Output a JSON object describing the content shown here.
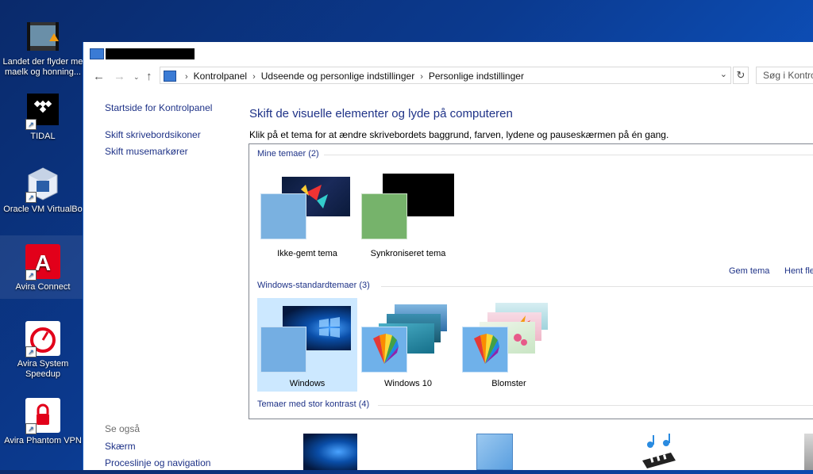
{
  "desktop": {
    "icons": [
      {
        "label1": "Landet der flyder me",
        "label2": "maelk og honning...",
        "icon": "video-file-icon"
      },
      {
        "label1": "TIDAL",
        "label2": "",
        "icon": "tidal-icon"
      },
      {
        "label1": "Oracle VM VirtualBo",
        "label2": "",
        "icon": "virtualbox-icon"
      },
      {
        "label1": "Avira Connect",
        "label2": "",
        "icon": "avira-connect-icon"
      },
      {
        "label1": "Avira System",
        "label2": "Speedup",
        "icon": "avira-speedup-icon"
      },
      {
        "label1": "Avira Phantom VPN",
        "label2": "",
        "icon": "avira-vpn-icon"
      }
    ]
  },
  "window": {
    "title": "",
    "address": {
      "crumbs": [
        "Kontrolpanel",
        "Udseende og personlige indstillinger",
        "Personlige indstillinger"
      ],
      "search_placeholder": "Søg i Kontrolpanel"
    }
  },
  "leftpane": {
    "links": [
      "Startside for Kontrolpanel",
      "Skift skrivebordsikoner",
      "Skift musemarkører"
    ],
    "see_also_title": "Se også",
    "see_also": [
      "Skærm",
      "Proceslinje og navigation"
    ]
  },
  "main": {
    "title": "Skift de visuelle elementer og lyde på computeren",
    "description": "Klik på et tema for at ændre skrivebordets baggrund, farven, lydene og pauseskærmen på én gang.",
    "groups": {
      "my_themes": "Mine temaer (2)",
      "standard": "Windows-standardtemaer (3)",
      "contrast": "Temaer med stor kontrast (4)"
    },
    "my_themes": [
      {
        "label": "Ikke-gemt tema",
        "swatch": "#7ab1e0"
      },
      {
        "label": "Synkroniseret tema",
        "swatch": "#76b36b"
      }
    ],
    "standard_themes": [
      {
        "label": "Windows",
        "selected": true
      },
      {
        "label": "Windows 10",
        "selected": false
      },
      {
        "label": "Blomster",
        "selected": false
      }
    ],
    "links": {
      "save": "Gem tema",
      "more": "Hent fle"
    }
  }
}
